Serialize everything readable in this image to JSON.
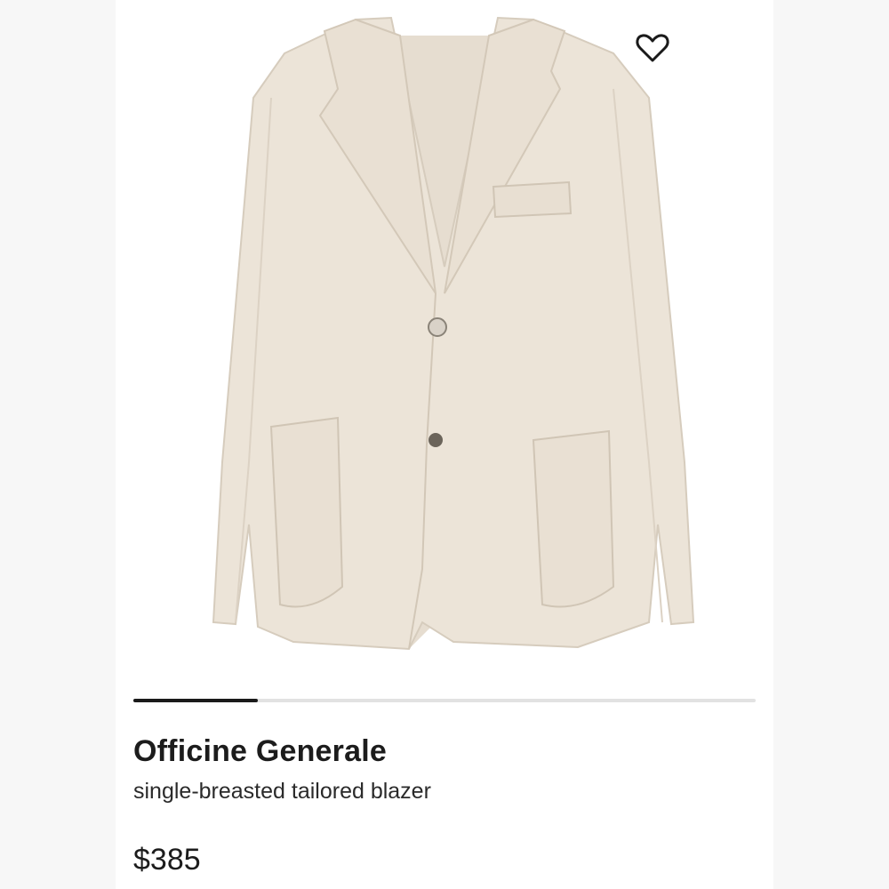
{
  "product": {
    "brand": "Officine Generale",
    "description": "single-breasted tailored blazer",
    "price": "$385"
  },
  "image": {
    "icon": "blazer-photo",
    "color": "#ece4d8"
  },
  "wishlist": {
    "icon": "heart-outline-icon"
  },
  "gallery": {
    "progress": 0.2
  },
  "colors": {
    "page_bg": "#f7f7f7",
    "card_bg": "#ffffff",
    "text": "#1c1c1c",
    "track": "#e2e2e2",
    "track_fill": "#1a1a1a"
  }
}
